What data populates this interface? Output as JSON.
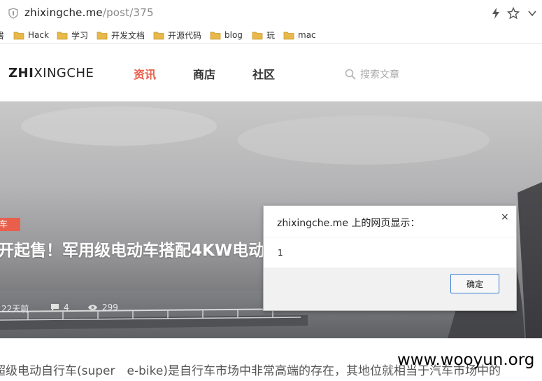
{
  "browser": {
    "url_host": "zhixingche.me",
    "url_path": "/post/375",
    "bookmarks": [
      {
        "label": "書",
        "icon": "folder-icon"
      },
      {
        "label": "Hack",
        "icon": "folder-icon"
      },
      {
        "label": "学习",
        "icon": "folder-icon"
      },
      {
        "label": "开发文档",
        "icon": "folder-icon"
      },
      {
        "label": "开源代码",
        "icon": "folder-icon"
      },
      {
        "label": "blog",
        "icon": "folder-icon"
      },
      {
        "label": "玩",
        "icon": "folder-icon"
      },
      {
        "label": "mac",
        "icon": "folder-icon"
      }
    ]
  },
  "site": {
    "logo_bold": "ZHI",
    "logo_rest": "XINGCHE",
    "nav": [
      {
        "label": "资讯",
        "active": true
      },
      {
        "label": "商店",
        "active": false
      },
      {
        "label": "社区",
        "active": false
      }
    ],
    "search_placeholder": "搜索文章",
    "accent_color": "#e8604c"
  },
  "hero": {
    "category": "车",
    "title": "开起售！军用级电动车搭配4KW电动",
    "time_ago": "22天前",
    "comments": "4",
    "views": "299"
  },
  "article": {
    "excerpt": "超级电动自行车(super　e-bike)是自行车市场中非常高端的存在，其地位就相当于汽车市场中的"
  },
  "watermark": "www.wooyun.org",
  "dialog": {
    "title": "zhixingche.me 上的网页显示：",
    "message": "1",
    "ok_label": "确定",
    "close_glyph": "×"
  }
}
